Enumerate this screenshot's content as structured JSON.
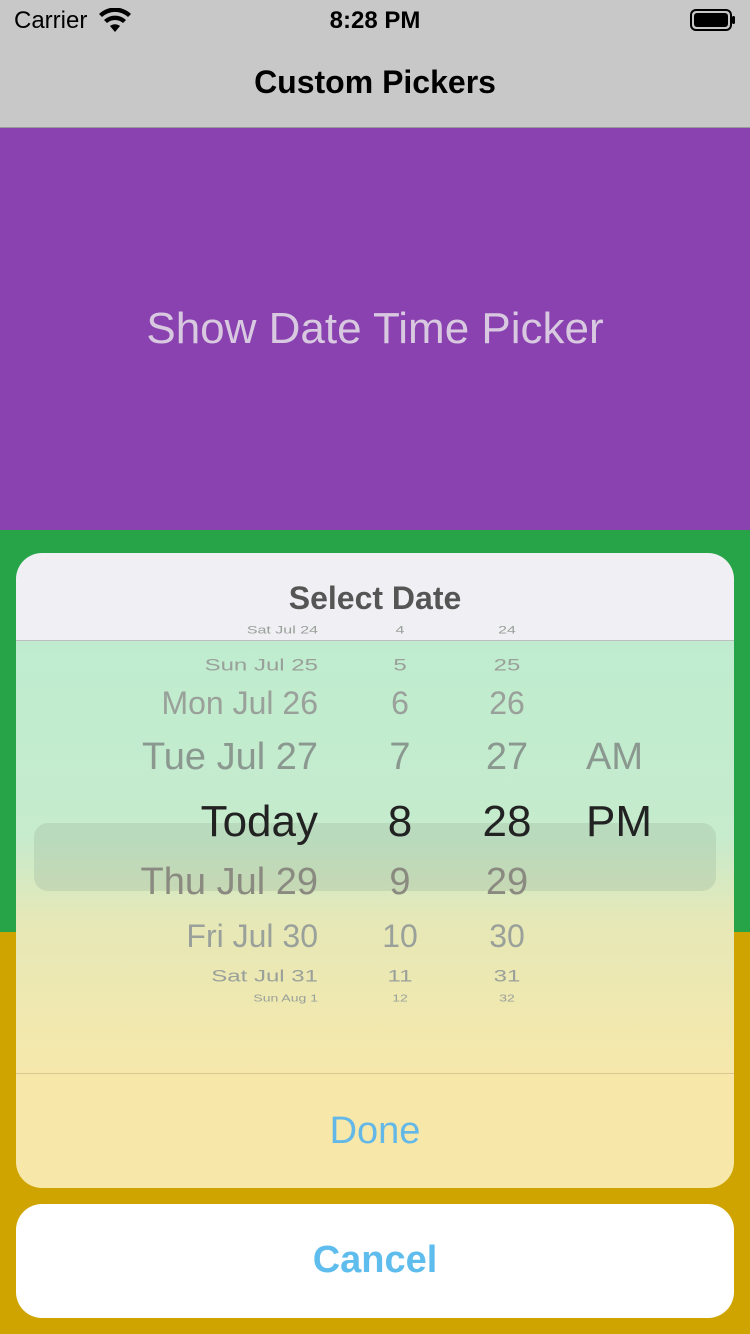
{
  "status_bar": {
    "carrier": "Carrier",
    "time": "8:28 PM"
  },
  "nav": {
    "title": "Custom Pickers"
  },
  "main": {
    "show_button_label": "Show Date Time Picker"
  },
  "sheet": {
    "title": "Select Date",
    "done_label": "Done",
    "cancel_label": "Cancel",
    "picker": {
      "rows": [
        {
          "date": "Sat Jul 24",
          "hour": "4",
          "minute": "24",
          "ampm": ""
        },
        {
          "date": "Sun Jul 25",
          "hour": "5",
          "minute": "25",
          "ampm": ""
        },
        {
          "date": "Mon Jul 26",
          "hour": "6",
          "minute": "26",
          "ampm": ""
        },
        {
          "date": "Tue Jul 27",
          "hour": "7",
          "minute": "27",
          "ampm": "AM"
        },
        {
          "date": "Today",
          "hour": "8",
          "minute": "28",
          "ampm": "PM"
        },
        {
          "date": "Thu Jul 29",
          "hour": "9",
          "minute": "29",
          "ampm": ""
        },
        {
          "date": "Fri Jul 30",
          "hour": "10",
          "minute": "30",
          "ampm": ""
        },
        {
          "date": "Sat Jul 31",
          "hour": "11",
          "minute": "31",
          "ampm": ""
        },
        {
          "date": "Sun Aug 1",
          "hour": "12",
          "minute": "32",
          "ampm": ""
        }
      ],
      "selected_index": 4
    }
  },
  "colors": {
    "purple": "#8a42b1",
    "green": "#28a448",
    "yellow": "#cfa400",
    "accent_blue": "#5fbdee"
  }
}
